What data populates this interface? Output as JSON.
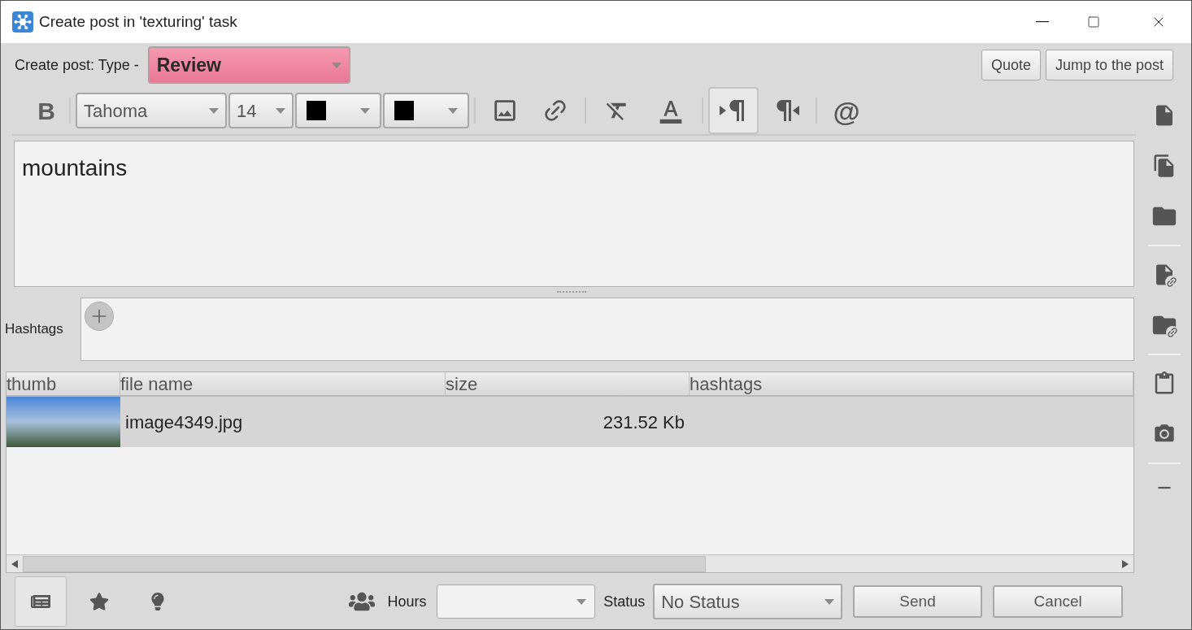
{
  "window": {
    "title": "Create post in 'texturing' task"
  },
  "post_type": {
    "label": "Create post: Type -",
    "value": "Review"
  },
  "header_buttons": [
    "Quote",
    "Jump to the post"
  ],
  "toolbar": {
    "bold": "B",
    "font": "Tahoma",
    "size": "14",
    "mention": "@",
    "color_pickers": [
      {
        "color": "#000000"
      },
      {
        "color": "#000000"
      }
    ],
    "text_direction": [
      {
        "kind": "ltr",
        "selected": true
      },
      {
        "kind": "rtl",
        "selected": false
      }
    ]
  },
  "editor": {
    "text": "mountains"
  },
  "hashtags": {
    "label": "Hashtags"
  },
  "table": {
    "columns": [
      "thumb",
      "file name",
      "size",
      "hashtags"
    ],
    "rows": [
      {
        "file_name": "image4349.jpg",
        "size": "231.52 Kb",
        "selected": true
      }
    ]
  },
  "footer": {
    "tools": [
      {
        "kind": "posts",
        "selected": true
      },
      {
        "kind": "star",
        "selected": false
      },
      {
        "kind": "bulb",
        "selected": false
      }
    ],
    "hours_label": "Hours",
    "status_label": "Status",
    "status_value": "No Status",
    "buttons": [
      "Send",
      "Cancel"
    ]
  }
}
